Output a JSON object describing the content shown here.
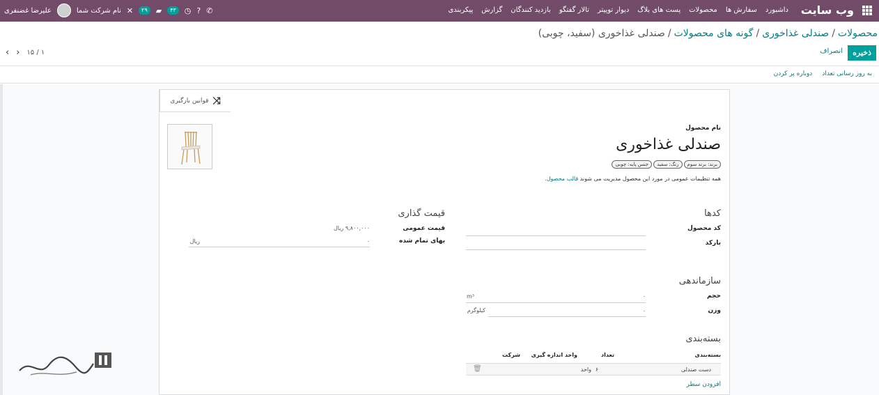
{
  "topnav": {
    "brand": "وب سایت",
    "menu": [
      "داشبورد",
      "سفارش ها",
      "محصولات",
      "پست های بلاگ",
      "دیوار توییتر",
      "تالار گفتگو",
      "بازدید کنندگان",
      "گزارش",
      "پیکربندی"
    ],
    "user_name": "علیرضا غضنفری",
    "company": "نام شرکت شما",
    "badge_messages": "۲۹",
    "badge_activities": "۴۳"
  },
  "breadcrumb": {
    "items": [
      "محصولات",
      "صندلی غذاخوری",
      "گونه های محصولات"
    ],
    "current": "صندلی غذاخوری (سفید، چوبی)"
  },
  "actions": {
    "save": "ذخیره",
    "discard": "انصراف"
  },
  "pager": {
    "value": "۱۵ / ۱"
  },
  "statusbar": {
    "update_qty": "به روز رسانی تعداد",
    "replenish": "دوباره پر کردن"
  },
  "sheet": {
    "smart_button": "قوانین بارگیری",
    "product_name_label": "نام محصول",
    "product_name": "صندلی غذاخوری",
    "tags": [
      "برند: برند سوم",
      "رنگ: سفید",
      "جنس پایه: چوبی"
    ],
    "note_text": "همه تنظیمات عمومی در مورد این محصول مدیریت می شوند",
    "note_link": "قالب محصول.",
    "codes": {
      "title": "کدها",
      "internal_ref": "کد محصول",
      "barcode": "بارکد"
    },
    "pricing": {
      "title": "قیمت گذاری",
      "public_price_label": "قیمت عمومی",
      "public_price": "۹,۸۰۰,۰۰۰ ریال",
      "cost_label": "بهای تمام شده",
      "cost_value": "۰",
      "cost_currency": "ریال"
    },
    "logistics": {
      "title": "سازماندهی",
      "volume_label": "حجم",
      "volume_value": "۰",
      "volume_unit": "m³",
      "weight_label": "وزن",
      "weight_value": "۰",
      "weight_unit": "کیلوگرم"
    },
    "packaging": {
      "title": "بسته‌بندی",
      "columns": [
        "بسته‌بندی",
        "تعداد",
        "واحد اندازه گیری",
        "شرکت"
      ],
      "rows": [
        {
          "name": "دست صندلی",
          "qty": "۶",
          "uom": "واحد",
          "company": ""
        }
      ],
      "add_line": "افزودن سطر"
    }
  },
  "colors": {
    "nav": "#714b67",
    "accent": "#00a09d",
    "link": "#017e84"
  }
}
